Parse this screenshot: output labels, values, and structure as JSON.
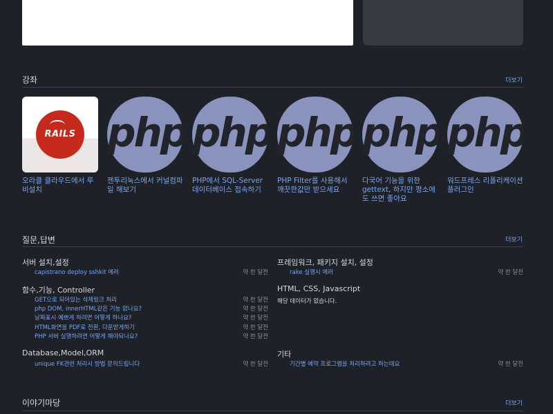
{
  "courses_section": {
    "title": "강좌",
    "more": "더보기",
    "items": [
      {
        "logo": "RAILS",
        "title": "오라클 클라우드에서 루비설치"
      },
      {
        "logo": "php",
        "title": "젠투리눅스에서 커널컴파일 해보기"
      },
      {
        "logo": "php",
        "title": "PHP에서 SQL-Server 데이터베이스 접속하기"
      },
      {
        "logo": "php",
        "title": "PHP Filter를 사용해서 깨끗한값만 받으세요"
      },
      {
        "logo": "php",
        "title": "다국어 기능을 위한 gettext, 하지만 평소에도 쓰면 좋아요"
      },
      {
        "logo": "php",
        "title": "워드프레스 리플리케이션 플러그인"
      }
    ]
  },
  "qa_section": {
    "title": "질문,답변",
    "more": "더보기",
    "left": [
      {
        "category": "서버 설치,설정",
        "questions": [
          {
            "title": "capistrano deploy sshkit 에러",
            "time": "약 한 달전"
          }
        ]
      },
      {
        "category": "함수,기능, Controller",
        "questions": [
          {
            "title": "GET으로 되어있는 삭제링크 처리",
            "time": "약 한 달전"
          },
          {
            "title": "php DOM, innerHTML같은 기능 없나요?",
            "time": "약 한 달전"
          },
          {
            "title": "날짜표시 예쁘게 하려면 어떻게 하나요?",
            "time": "약 한 달전"
          },
          {
            "title": "HTML화면을 PDF로 전환, 다운받게하기",
            "time": "약 한 달전"
          },
          {
            "title": "PHP 서버 실행하려면 어떻게 해야되나요?",
            "time": "약 한 달전"
          }
        ]
      },
      {
        "category": "Database,Model,ORM",
        "questions": [
          {
            "title": "unique FK관련 처리시 방법 문의드립니다",
            "time": "약 한 달전"
          }
        ]
      }
    ],
    "right": [
      {
        "category": "프레임워크, 패키지 설치, 설정",
        "questions": [
          {
            "title": "rake 실행시 에러",
            "time": "약 한 달전"
          }
        ]
      },
      {
        "category": "HTML, CSS, Javascript",
        "nodata": "해당 데이터가 없습니다."
      },
      {
        "category": "기타",
        "questions": [
          {
            "title": "기간별 예약 프로그램을 처리하려고 하는데요",
            "time": "약 한 달전"
          }
        ]
      }
    ]
  },
  "story_section": {
    "title": "이야기마당",
    "more": "더보기"
  },
  "colors": {
    "background": "#1e2128",
    "link": "#7aa6ee",
    "rails_red": "#c62a1d",
    "php_purple": "#8993be"
  }
}
